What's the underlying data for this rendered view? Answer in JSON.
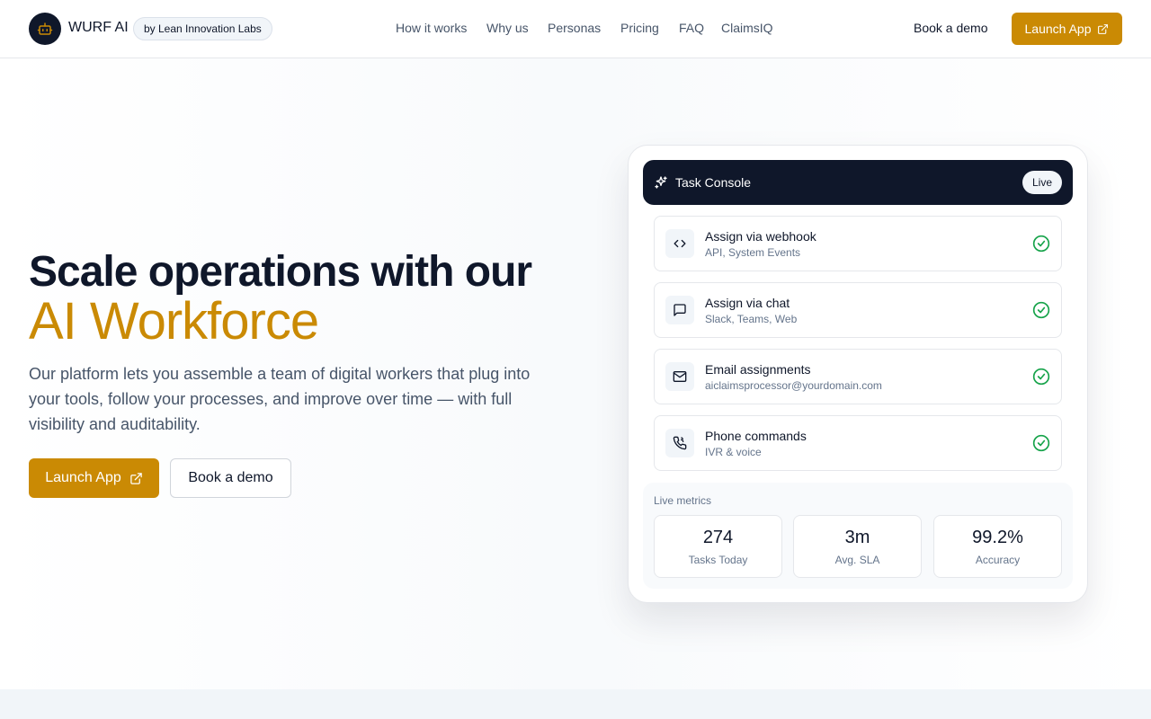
{
  "header": {
    "brand": "WURF AI",
    "badge": "by Lean Innovation Labs",
    "nav": [
      "How it works",
      "Why us",
      "Personas",
      "Pricing",
      "FAQ",
      "ClaimsIQ"
    ],
    "book_demo": "Book a demo",
    "launch_app": "Launch App",
    "logo_icon": "robot-icon",
    "launch_icon": "external-link-icon"
  },
  "hero": {
    "title_line1": "Scale operations with our",
    "title_line2": "AI Workforce",
    "description": "Our platform lets you assemble a team of digital workers that plug into your tools, follow your processes, and improve over time — with full visibility and auditability.",
    "launch_app": "Launch App",
    "book_demo": "Book a demo"
  },
  "console": {
    "title": "Task Console",
    "status": "Live",
    "channels": [
      {
        "title": "Assign via webhook",
        "subtitle": "API, System Events",
        "icon": "code-icon"
      },
      {
        "title": "Assign via chat",
        "subtitle": "Slack, Teams, Web",
        "icon": "chat-icon"
      },
      {
        "title": "Email assignments",
        "subtitle": "aiclaimsprocessor@yourdomain.com",
        "icon": "mail-icon"
      },
      {
        "title": "Phone commands",
        "subtitle": "IVR & voice",
        "icon": "phone-icon"
      }
    ],
    "metrics_label": "Live metrics",
    "metrics": [
      {
        "value": "274",
        "label": "Tasks Today"
      },
      {
        "value": "3m",
        "label": "Avg. SLA"
      },
      {
        "value": "99.2%",
        "label": "Accuracy"
      }
    ]
  },
  "colors": {
    "accent": "#ca8a04",
    "dark": "#0f172a",
    "success": "#16a34a"
  }
}
